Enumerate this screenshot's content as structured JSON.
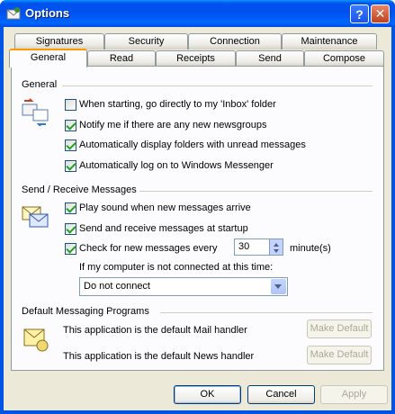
{
  "window": {
    "title": "Options"
  },
  "tabs_back": [
    "Signatures",
    "Security",
    "Connection",
    "Maintenance"
  ],
  "tabs_front": [
    "General",
    "Read",
    "Receipts",
    "Send",
    "Compose"
  ],
  "general": {
    "title": "General",
    "options": [
      {
        "label": "When starting, go directly to my 'Inbox' folder",
        "checked": false
      },
      {
        "label": "Notify me if there are any new newsgroups",
        "checked": true
      },
      {
        "label": "Automatically display folders with unread messages",
        "checked": true
      },
      {
        "label": "Automatically log on to Windows Messenger",
        "checked": true
      }
    ]
  },
  "send_receive": {
    "title": "Send / Receive Messages",
    "options": [
      {
        "label": "Play sound when new messages arrive",
        "checked": true
      },
      {
        "label": "Send and receive messages at startup",
        "checked": true
      },
      {
        "label": "Check for new messages every",
        "checked": true
      }
    ],
    "interval_value": "30",
    "interval_unit": "minute(s)",
    "not_connected_label": "If my computer is not connected at this time:",
    "not_connected_value": "Do not connect"
  },
  "default_programs": {
    "title": "Default Messaging Programs",
    "mail_text": "This application is the default Mail handler",
    "news_text": "This application is the default News handler",
    "make_default_label": "Make Default"
  },
  "buttons": {
    "ok": "OK",
    "cancel": "Cancel",
    "apply": "Apply"
  }
}
